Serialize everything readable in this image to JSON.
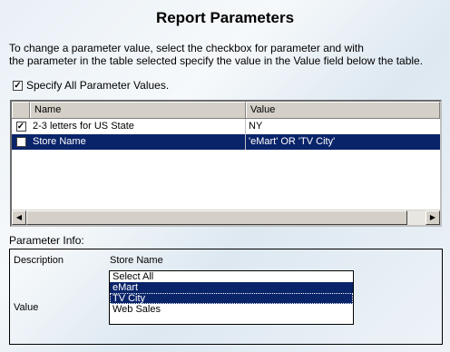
{
  "header": {
    "title": "Report Parameters",
    "instruction_line1": "To change a parameter value, select the checkbox for parameter and with",
    "instruction_line2": "the parameter in the table selected specify the value in the Value field below the table.",
    "specify_all_label": "Specify All Parameter Values.",
    "specify_all_checked": true
  },
  "table": {
    "columns": [
      "Name",
      "Value"
    ],
    "rows": [
      {
        "checked": true,
        "name": "2-3 letters for US State",
        "value": "NY",
        "selected": false
      },
      {
        "checked": true,
        "name": "Store Name",
        "value": "'eMart' OR 'TV City'",
        "selected": true
      }
    ]
  },
  "param_info": {
    "section_label": "Parameter Info:",
    "description_label": "Description",
    "description_value": "Store Name",
    "value_label": "Value",
    "options": [
      {
        "label": "Select All",
        "selected": false
      },
      {
        "label": "eMart",
        "selected": true
      },
      {
        "label": "TV City",
        "selected": true
      },
      {
        "label": "Web Sales",
        "selected": false
      }
    ]
  },
  "colors": {
    "selection": "#0a246a",
    "chrome": "#d4d0c8"
  }
}
